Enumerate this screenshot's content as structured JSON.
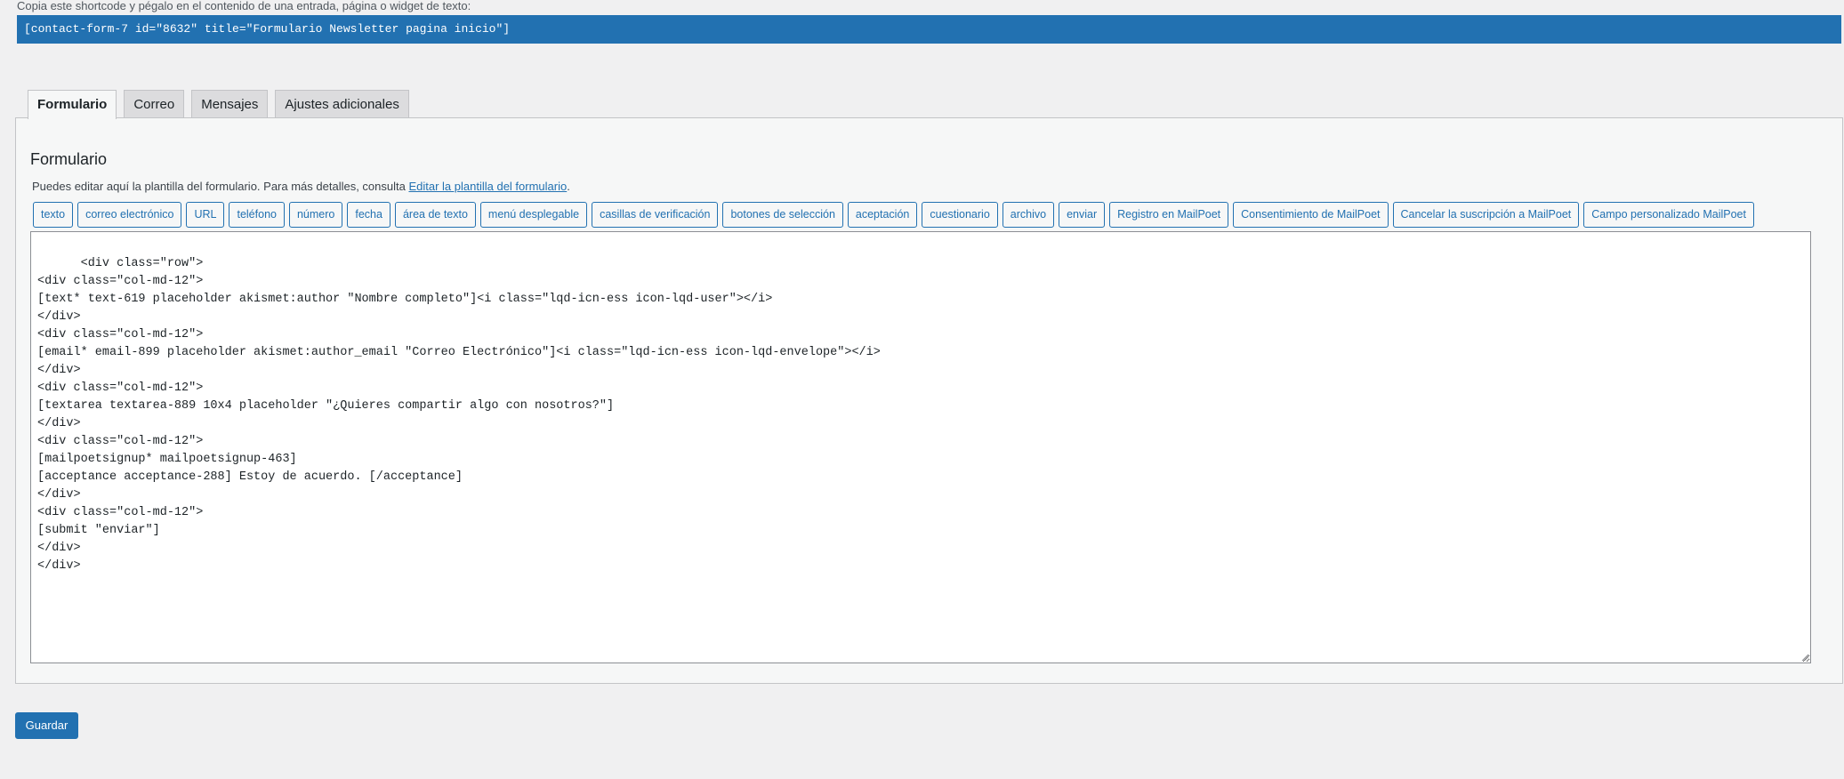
{
  "shortcode": {
    "note": "Copia este shortcode y pégalo en el contenido de una entrada, página o widget de texto:",
    "value": "[contact-form-7 id=\"8632\" title=\"Formulario Newsletter pagina inicio\"]"
  },
  "tabs": [
    {
      "label": "Formulario",
      "active": true
    },
    {
      "label": "Correo",
      "active": false
    },
    {
      "label": "Mensajes",
      "active": false
    },
    {
      "label": "Ajustes adicionales",
      "active": false
    }
  ],
  "panel": {
    "title": "Formulario",
    "description": "Puedes editar aquí la plantilla del formulario. Para más detalles, consulta ",
    "link_text": "Editar la plantilla del formulario",
    "description_end": "."
  },
  "tag_buttons": [
    "texto",
    "correo electrónico",
    "URL",
    "teléfono",
    "número",
    "fecha",
    "área de texto",
    "menú desplegable",
    "casillas de verificación",
    "botones de selección",
    "aceptación",
    "cuestionario",
    "archivo",
    "enviar",
    "Registro en MailPoet",
    "Consentimiento de MailPoet",
    "Cancelar la suscripción a MailPoet",
    "Campo personalizado MailPoet"
  ],
  "editor": {
    "content": "<div class=\"row\">\n<div class=\"col-md-12\">\n[text* text-619 placeholder akismet:author \"Nombre completo\"]<i class=\"lqd-icn-ess icon-lqd-user\"></i>\n</div>\n<div class=\"col-md-12\">\n[email* email-899 placeholder akismet:author_email \"Correo Electrónico\"]<i class=\"lqd-icn-ess icon-lqd-envelope\"></i>\n</div>\n<div class=\"col-md-12\">\n[textarea textarea-889 10x4 placeholder \"¿Quieres compartir algo con nosotros?\"]\n</div>\n<div class=\"col-md-12\">\n[mailpoetsignup* mailpoetsignup-463]\n[acceptance acceptance-288] Estoy de acuerdo. [/acceptance]\n</div>\n<div class=\"col-md-12\">\n[submit \"enviar\"]\n</div>\n</div>"
  },
  "save_button": "Guardar",
  "colors": {
    "accent": "#2271b1",
    "background": "#f0f0f1",
    "panel": "#f6f7f7",
    "border": "#c3c4c7"
  }
}
